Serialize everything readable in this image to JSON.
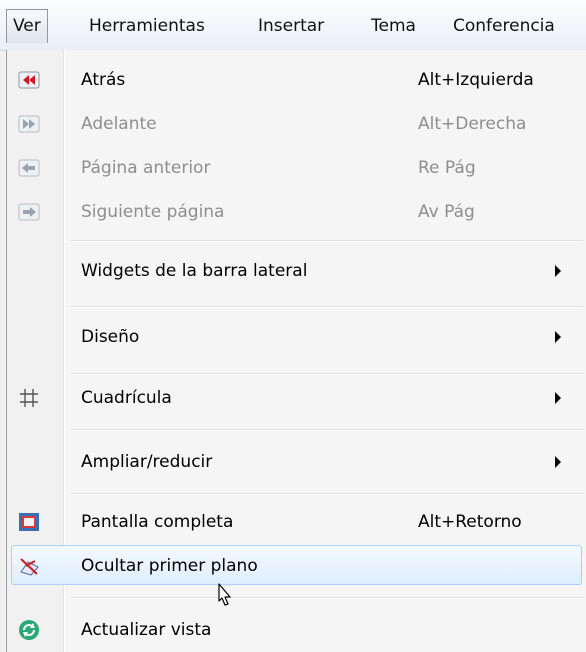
{
  "menubar": {
    "items": [
      "Ver",
      "Herramientas",
      "Insertar",
      "Tema",
      "Conferencia"
    ]
  },
  "menu": {
    "items": [
      {
        "label": "Atrás",
        "shortcut": "Alt+Izquierda",
        "icon": "back-arrow-icon",
        "enabled": true
      },
      {
        "label": "Adelante",
        "shortcut": "Alt+Derecha",
        "icon": "forward-arrow-icon",
        "enabled": false
      },
      {
        "label": "Página anterior",
        "shortcut": "Re Pág",
        "icon": "previous-page-icon",
        "enabled": false
      },
      {
        "label": "Siguiente página",
        "shortcut": "Av Pág",
        "icon": "next-page-icon",
        "enabled": false
      },
      {
        "label": "Widgets de la barra lateral",
        "submenu": true
      },
      {
        "label": "Diseño",
        "submenu": true
      },
      {
        "label": "Cuadrícula",
        "icon": "grid-icon",
        "submenu": true
      },
      {
        "label": "Ampliar/reducir",
        "submenu": true
      },
      {
        "label": "Pantalla completa",
        "shortcut": "Alt+Retorno",
        "icon": "fullscreen-icon",
        "enabled": true
      },
      {
        "label": "Ocultar primer plano",
        "icon": "hide-foreground-icon",
        "highlighted": true
      },
      {
        "label": "Actualizar vista",
        "icon": "refresh-icon"
      }
    ]
  },
  "colors": {
    "accent_red": "#c81e1e",
    "highlight_border": "#aecff7",
    "disabled_text": "#8e8e8e",
    "refresh_green": "#2aa876"
  }
}
